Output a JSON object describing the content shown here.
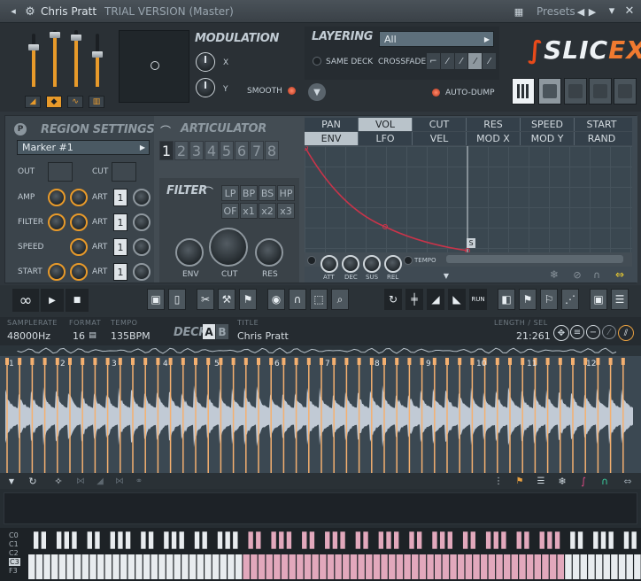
{
  "window": {
    "title": "Chris Pratt",
    "subtitle": "TRIAL VERSION (Master)",
    "presets_label": "Presets",
    "close": "✕"
  },
  "modulation": {
    "title": "MODULATION",
    "x_label": "X",
    "y_label": "Y",
    "smooth_label": "SMOOTH"
  },
  "layering": {
    "title": "LAYERING",
    "dropdown_value": "All",
    "same_deck_label": "SAME DECK",
    "crossfade_label": "CROSSFADE",
    "auto_dump_label": "AUTO-DUMP"
  },
  "logo": {
    "text_slic": "SLIC",
    "text_ex": "EX"
  },
  "region": {
    "title": "REGION SETTINGS",
    "marker_value": "Marker #1",
    "out_label": "OUT",
    "cut_label": "CUT",
    "amp_label": "AMP",
    "filter_label": "FILTER",
    "speed_label": "SPEED",
    "start_label": "START",
    "art_label": "ART",
    "art_values": [
      "1",
      "1",
      "1",
      "1"
    ]
  },
  "articulator": {
    "title": "ARTICULATOR",
    "numbers": [
      "1",
      "2",
      "3",
      "4",
      "5",
      "6",
      "7",
      "8"
    ],
    "active": "1"
  },
  "filter": {
    "title": "FILTER",
    "types": [
      "LP",
      "BP",
      "BS",
      "HP"
    ],
    "of_label": "OF",
    "mult": [
      "x1",
      "x2",
      "x3"
    ],
    "env_label": "ENV",
    "cut_label": "CUT",
    "res_label": "RES"
  },
  "envelope": {
    "tabs_row1": [
      "PAN",
      "VOL",
      "CUT",
      "RES",
      "SPEED",
      "START"
    ],
    "tabs_row2": [
      "ENV",
      "LFO",
      "VEL",
      "MOD X",
      "MOD Y",
      "RAND"
    ],
    "active_row1": "VOL",
    "active_row2": "ENV",
    "knobs": [
      "ATT",
      "DEC",
      "SUS",
      "REL"
    ],
    "tempo_label": "TEMPO",
    "sustain_marker": "S"
  },
  "transport": {
    "loop_icon": "∞",
    "play_icon": "▶",
    "stop_icon": "■"
  },
  "info": {
    "samplerate_label": "SAMPLERATE",
    "samplerate": "48000Hz",
    "format_label": "FORMAT",
    "format": "16",
    "tempo_label": "TEMPO",
    "tempo": "135BPM",
    "deck_label": "DECK",
    "deck_a": "A",
    "deck_b": "B",
    "title_label": "TITLE",
    "title": "Chris Pratt",
    "length_label": "LENGTH / SEL",
    "length": "21:261"
  },
  "markers": [
    "1",
    "2",
    "3",
    "4",
    "5",
    "6",
    "7",
    "8",
    "9",
    "10",
    "11",
    "12"
  ],
  "octaves": [
    "C0",
    "C1",
    "C2",
    "C3",
    "F3"
  ],
  "colors": {
    "accent": "#f0a030",
    "marker": "#f4b070",
    "wave": "#c8d2dc",
    "key_pink": "#e2a8bc",
    "logo_red": "#e84a1a"
  }
}
